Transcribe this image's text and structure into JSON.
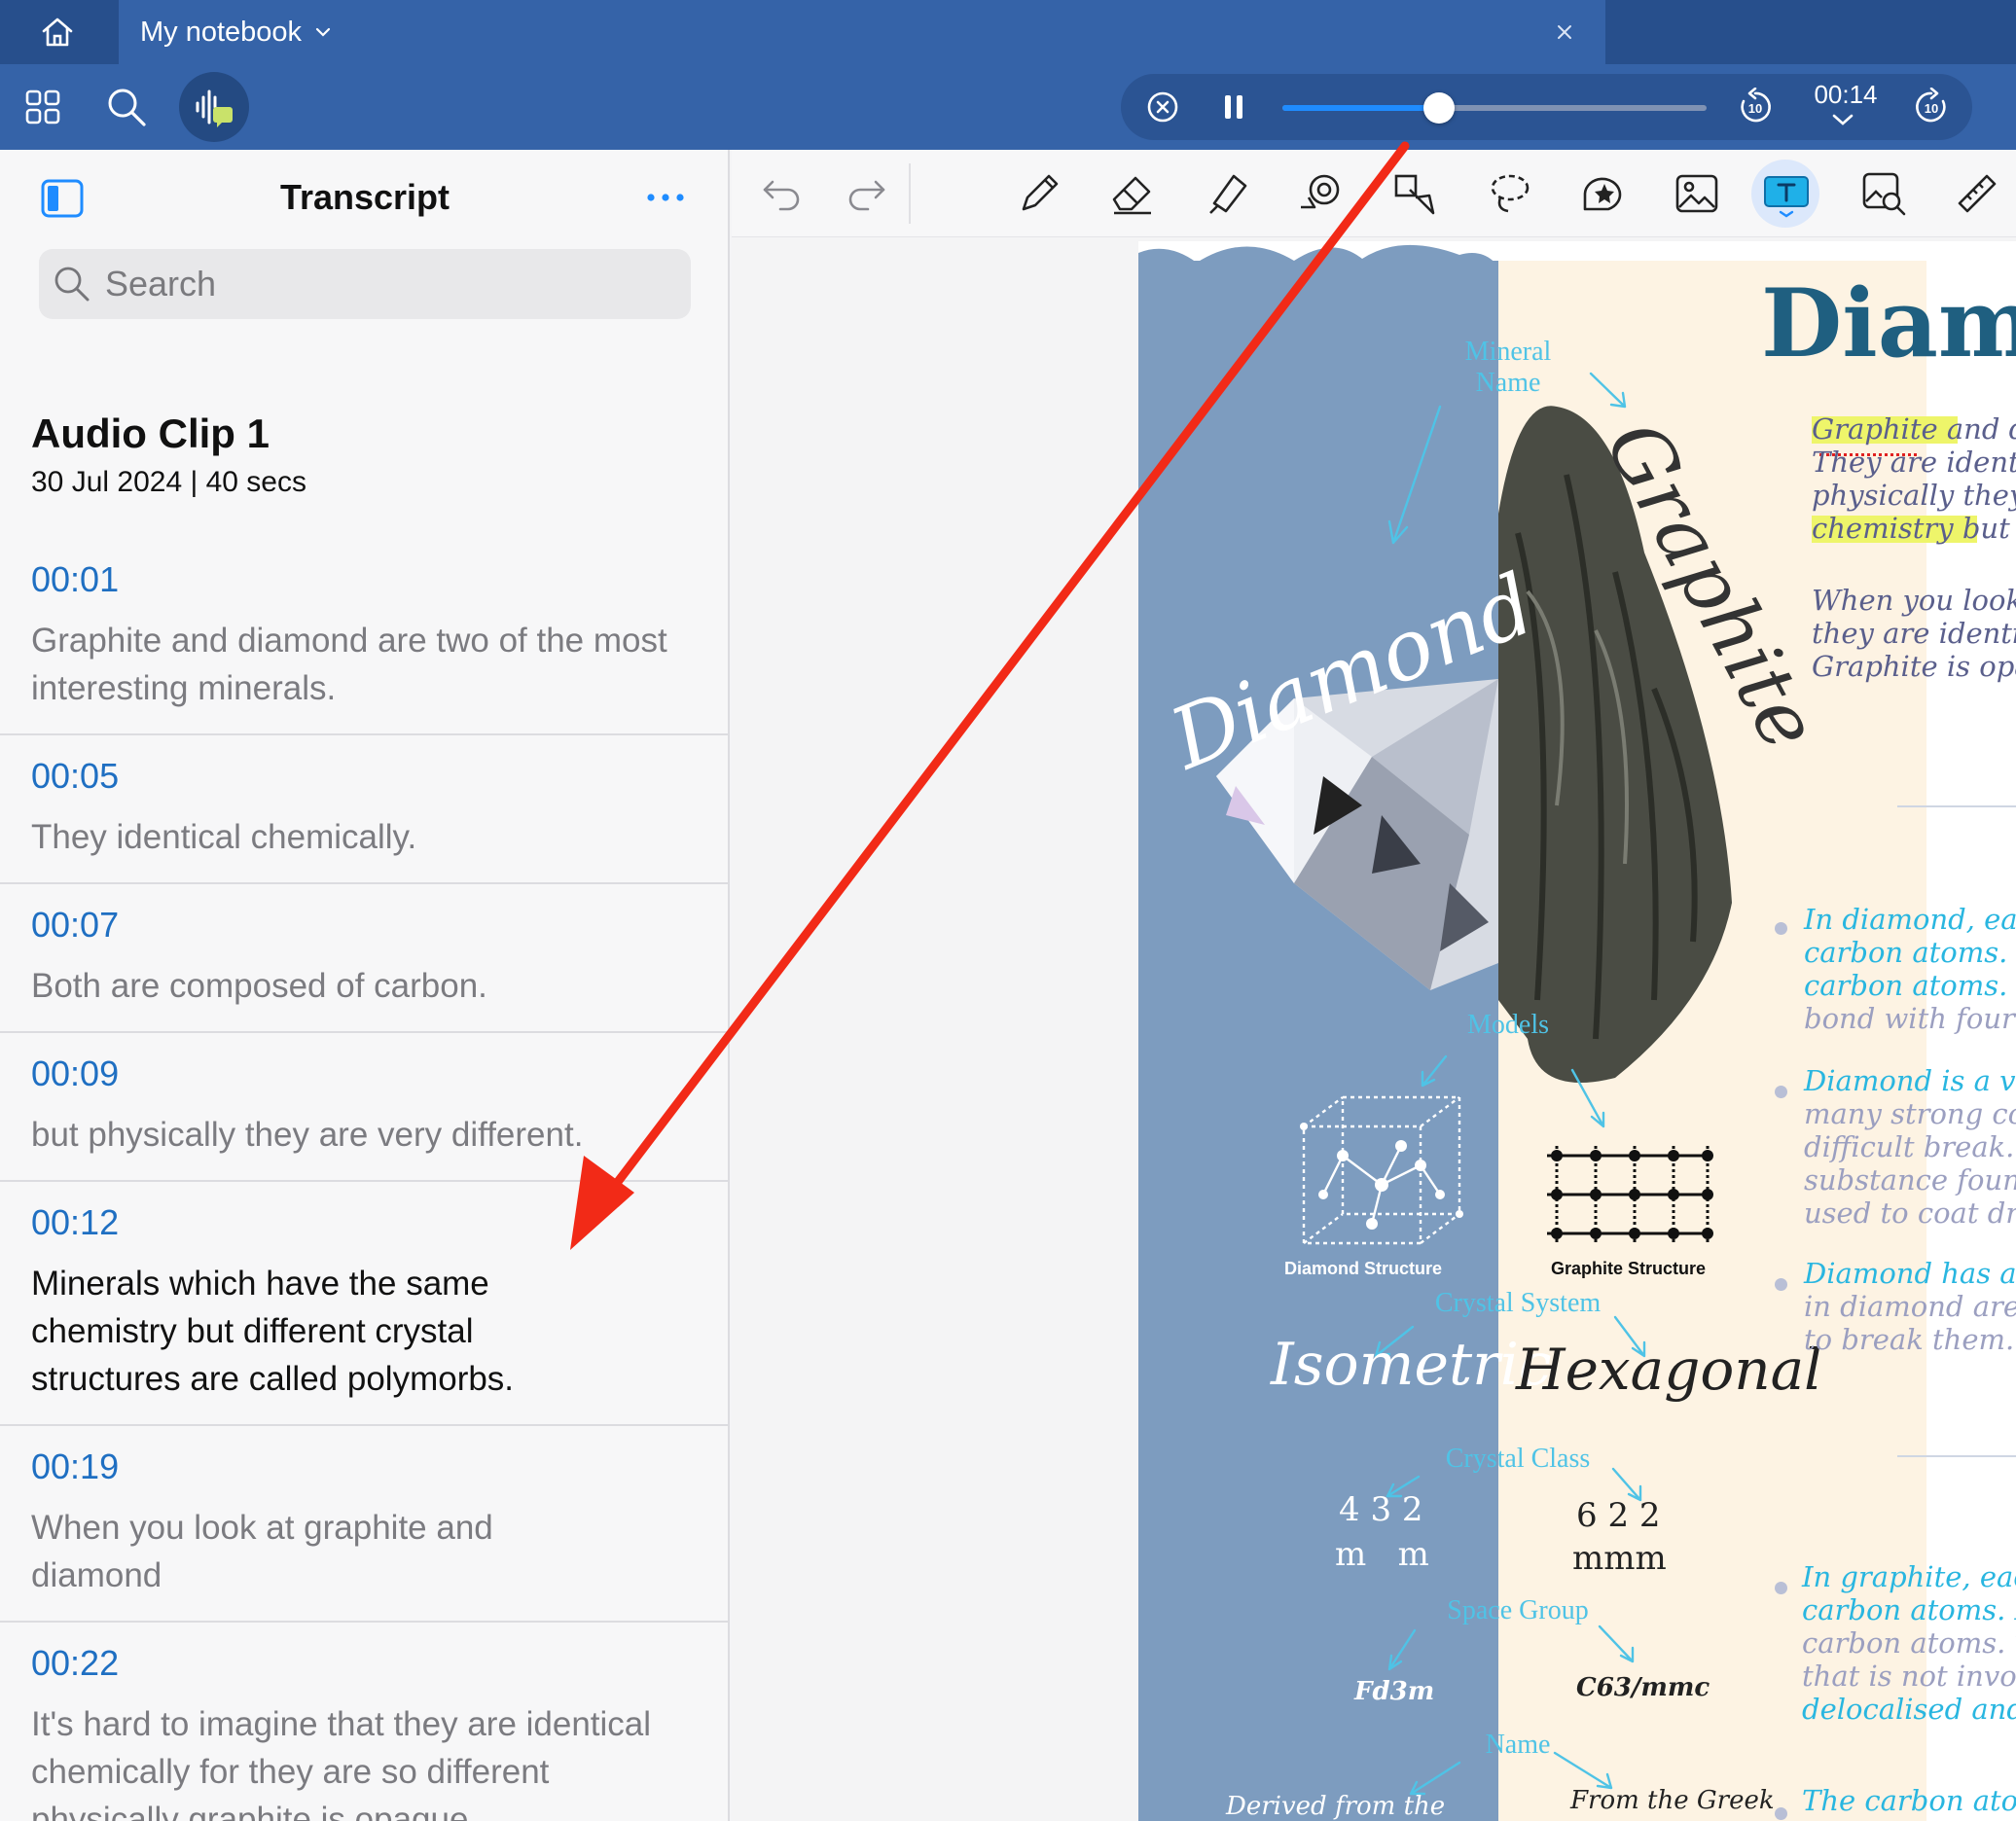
{
  "tabbar": {
    "tab_title": "My notebook"
  },
  "player": {
    "time": "00:14",
    "progress": 0.37,
    "rewind_seconds": "10",
    "forward_seconds": "10"
  },
  "transcript": {
    "title": "Transcript",
    "search_placeholder": "Search",
    "clip_title": "Audio Clip 1",
    "clip_meta": "30 Jul 2024 | 40 secs",
    "entries": [
      {
        "time": "00:01",
        "text": "Graphite and diamond are two of the most interesting minerals."
      },
      {
        "time": "00:05",
        "text": "They identical chemically."
      },
      {
        "time": "00:07",
        "text": "Both are composed of carbon."
      },
      {
        "time": "00:09",
        "text": "but physically they are very different."
      },
      {
        "time": "00:12",
        "text": "Minerals which have the same chemistry but different crystal structures are called polymorbs."
      },
      {
        "time": "00:19",
        "text": "When you look at graphite and diamond"
      },
      {
        "time": "00:22",
        "text": "It's hard to imagine that they are identical chemically for they are so different physically graphite is opaque"
      }
    ]
  },
  "note": {
    "heading": "Diamo",
    "diamond_word": "Diamond",
    "graphite_word": "Graphite",
    "label_mineral": "Mineral",
    "label_name": "Name",
    "label_models": "Models",
    "label_crystal_system": "Crystal System",
    "label_crystal_class": "Crystal Class",
    "label_space_group": "Space Group",
    "label_name2": "Name",
    "diamond_structure": "Diamond Structure",
    "graphite_structure": "Graphite Structure",
    "isometric": "Isometric",
    "hexagonal": "Hexagonal",
    "class_diamond_top": "4 3 2",
    "class_diamond_bottom": "m   m",
    "class_graphite_top": "6 2 2",
    "class_graphite_bottom": "mmm",
    "space_diamond": "Fd3m",
    "space_graphite": "C63/mmc",
    "name_diamond": "Derived from the",
    "name_graphite": "From the Greek",
    "right_lines_1": [
      "Graphite and d",
      "They are identica",
      "physically they",
      "chemistry but d"
    ],
    "right_lines_2": [
      "When you look a",
      "they are identica",
      "Graphite is opaqu"
    ],
    "bullet_1": [
      "In diamond, each",
      "carbon atoms. In d",
      "carbon atoms. Thi",
      "bond with four oth"
    ],
    "bullet_2": [
      "Diamond is a very",
      "many strong cov",
      "difficult break. It",
      "substance found on",
      "used to coat dril"
    ],
    "bullet_3": [
      "Diamond has a h",
      "in diamond are",
      "to break them."
    ],
    "bullet_4": [
      "In graphite, each c",
      "carbon atoms. In g",
      "carbon atoms. This",
      "that is not involve",
      "delocalised and is"
    ],
    "bullet_5": [
      "The carbon atoms"
    ]
  },
  "colors": {
    "accent": "#1f8cff",
    "toolbar": "#3563a8",
    "timestamp": "#1f6fc2",
    "arrow": "#f22a17"
  }
}
